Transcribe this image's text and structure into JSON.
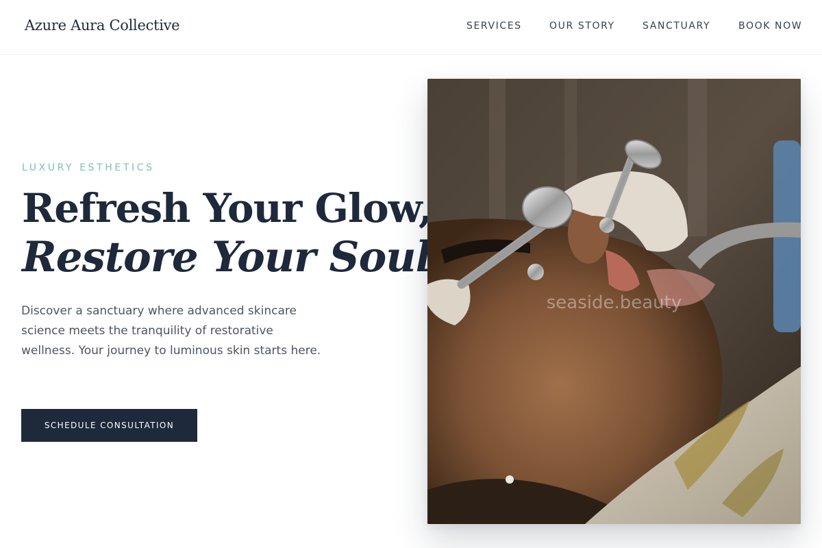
{
  "brand": {
    "name": "Azure Aura Collective"
  },
  "nav": {
    "items": [
      {
        "label": "SERVICES"
      },
      {
        "label": "OUR STORY"
      },
      {
        "label": "SANCTUARY"
      },
      {
        "label": "BOOK NOW"
      }
    ]
  },
  "hero": {
    "eyebrow": "LUXURY ESTHETICS",
    "headline_line1": "Refresh Your Glow,",
    "headline_line2": "Restore Your Soul.",
    "lead": "Discover a sanctuary where advanced skincare science meets the tranquility of restorative wellness. Your journey to luminous skin starts here.",
    "cta_label": "SCHEDULE CONSULTATION",
    "image_watermark": "seaside.beauty"
  },
  "colors": {
    "navy": "#1e293b",
    "teal_accent": "#7bbfb9",
    "body_text": "#4b5563"
  }
}
